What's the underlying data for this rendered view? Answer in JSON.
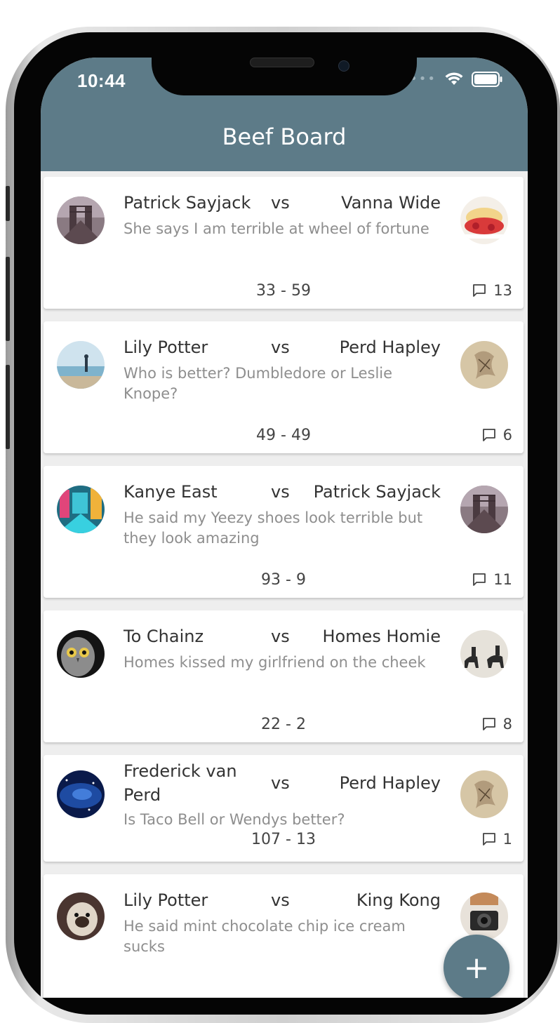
{
  "status_bar": {
    "time": "10:44"
  },
  "header": {
    "title": "Beef Board"
  },
  "fab": {
    "label": "+"
  },
  "beefs": [
    {
      "challenger": "Patrick Sayjack",
      "vs": "vs",
      "opponent": "Vanna Wide",
      "description": "She says I am terrible at wheel of fortune",
      "score": "33  -  59",
      "comments": "13",
      "avatar_left": "bridge-photo",
      "avatar_right": "dessert-photo"
    },
    {
      "challenger": "Lily Potter",
      "vs": "vs",
      "opponent": "Perd Hapley",
      "description": "Who is better? Dumbledore or Leslie Knope?",
      "score": "49  -  49",
      "comments": "6",
      "avatar_left": "beach-photo",
      "avatar_right": "sketch-photo"
    },
    {
      "challenger": "Kanye East",
      "vs": "vs",
      "opponent": "Patrick Sayjack",
      "description": "He said my Yeezy shoes look terrible but they look amazing",
      "score": "93  -  9",
      "comments": "11",
      "avatar_left": "city-lights-photo",
      "avatar_right": "bridge-photo"
    },
    {
      "challenger": "To Chainz",
      "vs": "vs",
      "opponent": "Homes Homie",
      "description": "Homes kissed my girlfriend on the cheek",
      "score": "22  -  2",
      "comments": "8",
      "avatar_left": "owl-photo",
      "avatar_right": "horse-riders-photo"
    },
    {
      "challenger": "Frederick van Perd",
      "vs": "vs",
      "opponent": "Perd Hapley",
      "description": "Is Taco Bell or Wendys better?",
      "score": "107  -  13",
      "comments": "1",
      "avatar_left": "galaxy-photo",
      "avatar_right": "sketch-photo"
    },
    {
      "challenger": "Lily Potter",
      "vs": "vs",
      "opponent": "King Kong",
      "description": "He said mint chocolate chip ice cream sucks",
      "score": "",
      "comments": "",
      "avatar_left": "pug-photo",
      "avatar_right": "photographer-photo"
    }
  ],
  "colors": {
    "header": "#5d7b88",
    "background": "#eeeeee",
    "card": "#ffffff"
  }
}
